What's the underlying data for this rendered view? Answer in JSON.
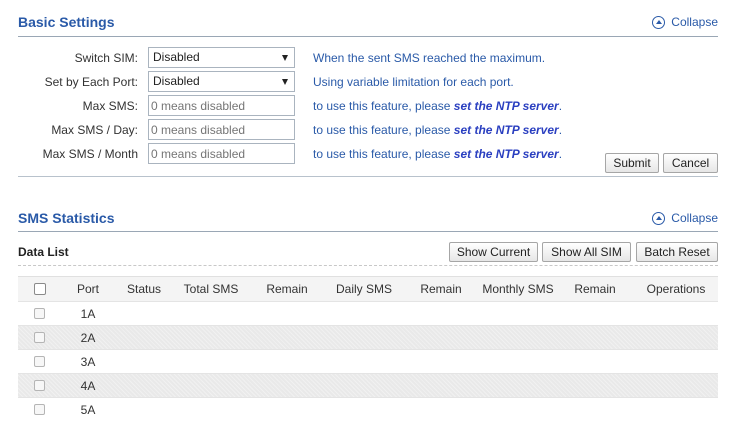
{
  "basic": {
    "title": "Basic Settings",
    "collapse_label": "Collapse",
    "fields": [
      {
        "label": "Switch SIM:",
        "type": "select",
        "value": "Disabled",
        "hint": "When the sent SMS reached the maximum."
      },
      {
        "label": "Set by Each Port:",
        "type": "select",
        "value": "Disabled",
        "hint": "Using variable limitation for each port."
      },
      {
        "label": "Max SMS:",
        "type": "input",
        "placeholder": "0 means disabled",
        "hint_prefix": "to use this feature, please ",
        "hint_link": "set the NTP server",
        "hint_suffix": "."
      },
      {
        "label": "Max SMS / Day:",
        "type": "input",
        "placeholder": "0 means disabled",
        "hint_prefix": "to use this feature, please ",
        "hint_link": "set the NTP server",
        "hint_suffix": "."
      },
      {
        "label": "Max SMS / Month",
        "type": "input",
        "placeholder": "0 means disabled",
        "hint_prefix": "to use this feature, please ",
        "hint_link": "set the NTP server",
        "hint_suffix": "."
      }
    ],
    "submit_label": "Submit",
    "cancel_label": "Cancel"
  },
  "stats": {
    "title": "SMS Statistics",
    "collapse_label": "Collapse",
    "datalist_title": "Data List",
    "buttons": {
      "show_current": "Show Current",
      "show_all_sim": "Show All SIM",
      "batch_reset": "Batch Reset"
    },
    "columns": [
      "Port",
      "Status",
      "Total SMS",
      "Remain",
      "Daily SMS",
      "Remain",
      "Monthly SMS",
      "Remain",
      "Operations"
    ],
    "rows": [
      {
        "port": "1A"
      },
      {
        "port": "2A"
      },
      {
        "port": "3A"
      },
      {
        "port": "4A"
      },
      {
        "port": "5A"
      }
    ]
  },
  "colors": {
    "accent": "#2a5aa8",
    "link": "#2a3fc0"
  }
}
